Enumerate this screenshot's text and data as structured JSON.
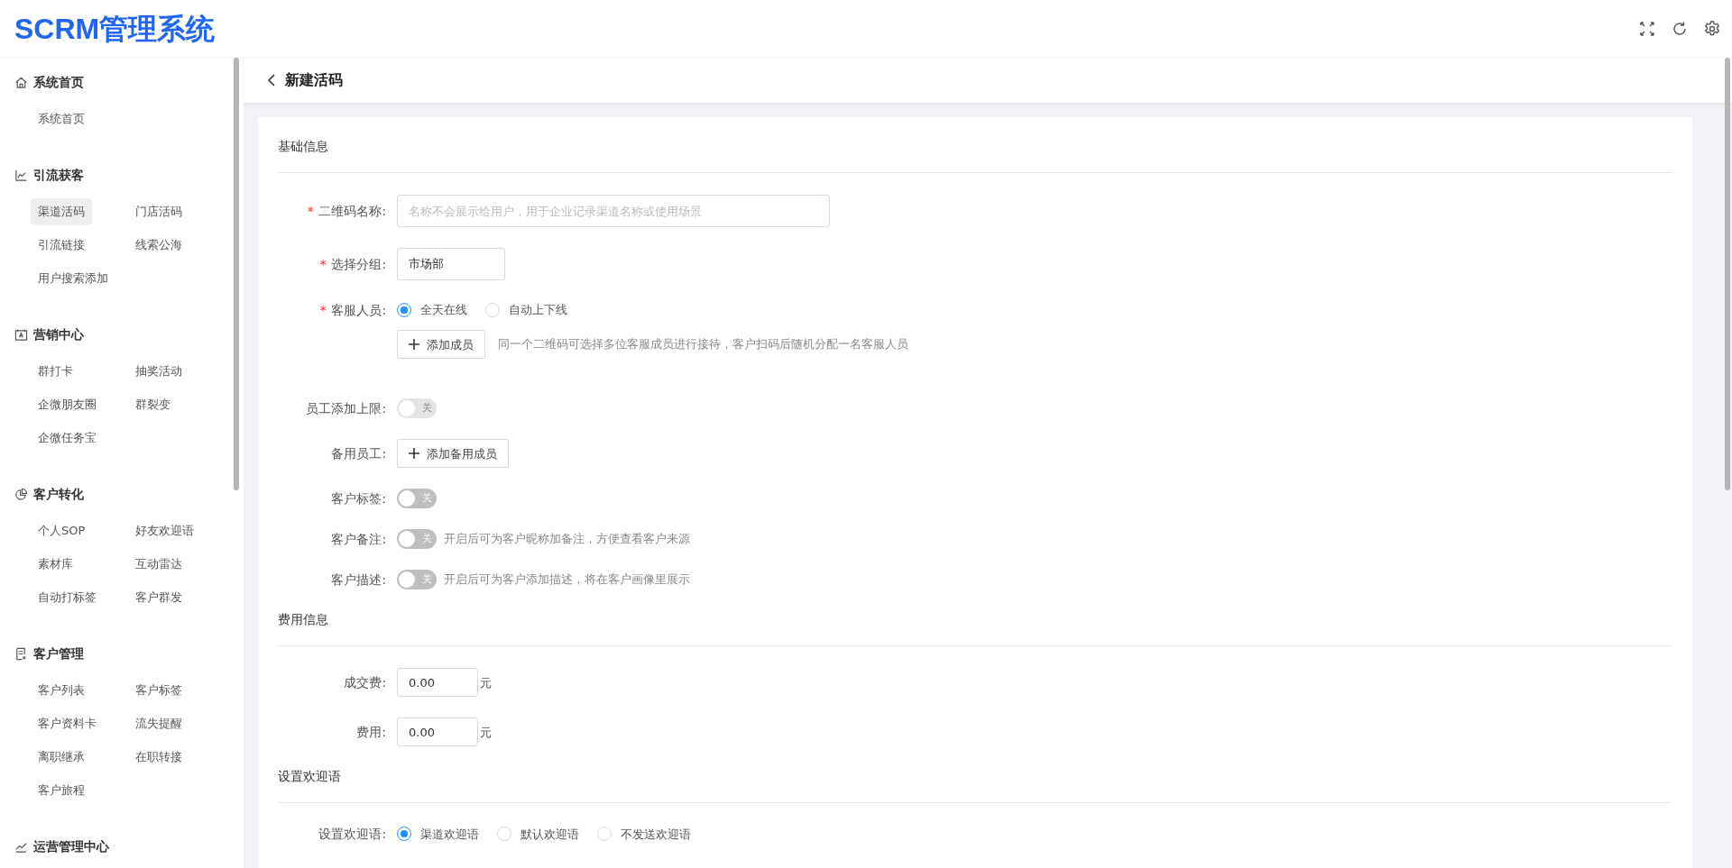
{
  "app_title": "SCRM管理系统",
  "sidebar": {
    "groups": [
      {
        "title": "系统首页",
        "kind": "home",
        "items": [
          {
            "label": "系统首页",
            "selected": false
          }
        ]
      },
      {
        "title": "引流获客",
        "kind": "chart",
        "items": [
          {
            "label": "渠道活码",
            "selected": true
          },
          {
            "label": "门店活码",
            "selected": false
          },
          {
            "label": "引流链接",
            "selected": false
          },
          {
            "label": "线索公海",
            "selected": false
          },
          {
            "label": "用户搜索添加",
            "selected": false
          }
        ]
      },
      {
        "title": "营销中心",
        "kind": "calendar",
        "items": [
          {
            "label": "群打卡",
            "selected": false
          },
          {
            "label": "抽奖活动",
            "selected": false
          },
          {
            "label": "企微朋友圈",
            "selected": false
          },
          {
            "label": "群裂变",
            "selected": false
          },
          {
            "label": "企微任务宝",
            "selected": false
          }
        ]
      },
      {
        "title": "客户转化",
        "kind": "pie",
        "items": [
          {
            "label": "个人SOP",
            "selected": false
          },
          {
            "label": "好友欢迎语",
            "selected": false
          },
          {
            "label": "素材库",
            "selected": false
          },
          {
            "label": "互动雷达",
            "selected": false
          },
          {
            "label": "自动打标签",
            "selected": false
          },
          {
            "label": "客户群发",
            "selected": false
          }
        ]
      },
      {
        "title": "客户管理",
        "kind": "doc",
        "items": [
          {
            "label": "客户列表",
            "selected": false
          },
          {
            "label": "客户标签",
            "selected": false
          },
          {
            "label": "客户资料卡",
            "selected": false
          },
          {
            "label": "流失提醒",
            "selected": false
          },
          {
            "label": "离职继承",
            "selected": false
          },
          {
            "label": "在职转接",
            "selected": false
          },
          {
            "label": "客户旅程",
            "selected": false
          }
        ]
      },
      {
        "title": "运营管理中心",
        "kind": "trend"
      }
    ]
  },
  "page_title": "新建活码",
  "sections": [
    {
      "title": "基础信息",
      "fields": [
        {
          "kind": "text",
          "label": "二维码名称:",
          "required_mark": "*",
          "placeholder": "名称不会展示给用户，用于企业记录渠道名称或使用场景"
        },
        {
          "kind": "select",
          "label": "选择分组:",
          "required_mark": "*",
          "value": "市场部"
        },
        {
          "kind": "radio",
          "label": "客服人员:",
          "required_mark": "*",
          "options": [
            {
              "label": "全天在线",
              "selected": true
            },
            {
              "label": "自动上下线",
              "selected": false
            }
          ]
        },
        {
          "kind": "button",
          "button": "添加成员",
          "hint": "同一个二维码可选择多位客服成员进行接待，客户扫码后随机分配一名客服人员"
        },
        {
          "kind": "toggle",
          "label": "员工添加上限:",
          "on": false,
          "disabled": true,
          "text": "关"
        },
        {
          "kind": "button",
          "label": "备用员工:",
          "button": "添加备用成员"
        },
        {
          "kind": "toggle",
          "label": "客户标签:",
          "on": false,
          "disabled": false,
          "text": "关"
        },
        {
          "kind": "toggle",
          "label": "客户备注:",
          "on": false,
          "disabled": false,
          "text": "关",
          "hint": "开启后可为客户昵称加备注，方便查看客户来源"
        },
        {
          "kind": "toggle",
          "label": "客户描述:",
          "on": false,
          "disabled": false,
          "text": "关",
          "hint": "开启后可为客户添加描述，将在客户画像里展示"
        }
      ]
    },
    {
      "title": "费用信息",
      "fields": [
        {
          "kind": "money",
          "label": "成交费:",
          "value": "0.00",
          "unit": "元"
        },
        {
          "kind": "money",
          "label": "费用:",
          "value": "0.00",
          "unit": "元"
        }
      ]
    },
    {
      "title": "设置欢迎语",
      "fields": [
        {
          "kind": "radio",
          "label": "设置欢迎语:",
          "options": [
            {
              "label": "渠道欢迎语",
              "selected": true
            },
            {
              "label": "默认欢迎语",
              "selected": false
            },
            {
              "label": "不发送欢迎语",
              "selected": false
            }
          ]
        }
      ]
    }
  ]
}
